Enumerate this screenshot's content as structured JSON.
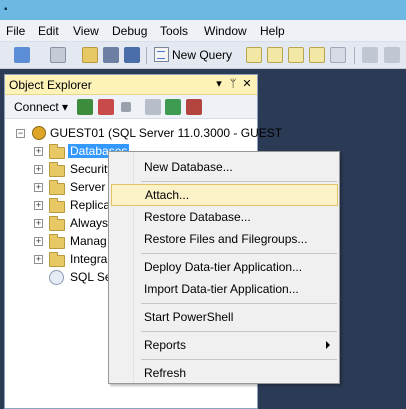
{
  "menubar": {
    "items": [
      "File",
      "Edit",
      "View",
      "Debug",
      "Tools",
      "Window",
      "Help"
    ]
  },
  "toolbar": {
    "new_query_label": "New Query"
  },
  "object_explorer": {
    "title": "Object Explorer",
    "connect_label": "Connect",
    "server_node": "GUEST01 (SQL Server 11.0.3000 - GUEST",
    "nodes": [
      "Databases",
      "Security",
      "Server O",
      "Replicat",
      "Always",
      "Manag",
      "Integra",
      "SQL Se"
    ]
  },
  "context_menu": {
    "items": [
      "New Database...",
      "Attach...",
      "Restore Database...",
      "Restore Files and Filegroups...",
      "Deploy Data-tier Application...",
      "Import Data-tier Application...",
      "Start PowerShell",
      "Reports",
      "Refresh"
    ],
    "highlighted": "Attach..."
  }
}
